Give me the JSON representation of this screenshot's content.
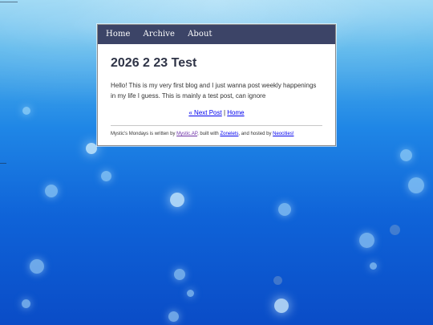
{
  "nav": {
    "items": [
      {
        "label": "Home"
      },
      {
        "label": "Archive"
      },
      {
        "label": "About"
      }
    ]
  },
  "post": {
    "title": "2026 2 23 Test",
    "body": "Hello! This is my very first blog and I just wanna post weekly happenings in my life I guess. This is mainly a test post, can ignore"
  },
  "post_nav": {
    "next_label": "« Next Post",
    "separator": "|",
    "home_label": "Home"
  },
  "footer": {
    "site_name": "Mystic's Mondays",
    "text_written_by": " is written by ",
    "author_link": "Mystic.AP",
    "text_built_with": ", built with ",
    "builder_link": "Zonelets",
    "text_hosted_by": ", and hosted by ",
    "host_link": "Neocities!"
  },
  "colors": {
    "navbar": "#3c4467",
    "title": "#2f3447",
    "link": "#0000ee",
    "visited_link": "#6b2fa6",
    "ocean_deep": "#0a4cc7",
    "ocean_light": "#8fd3f3"
  }
}
